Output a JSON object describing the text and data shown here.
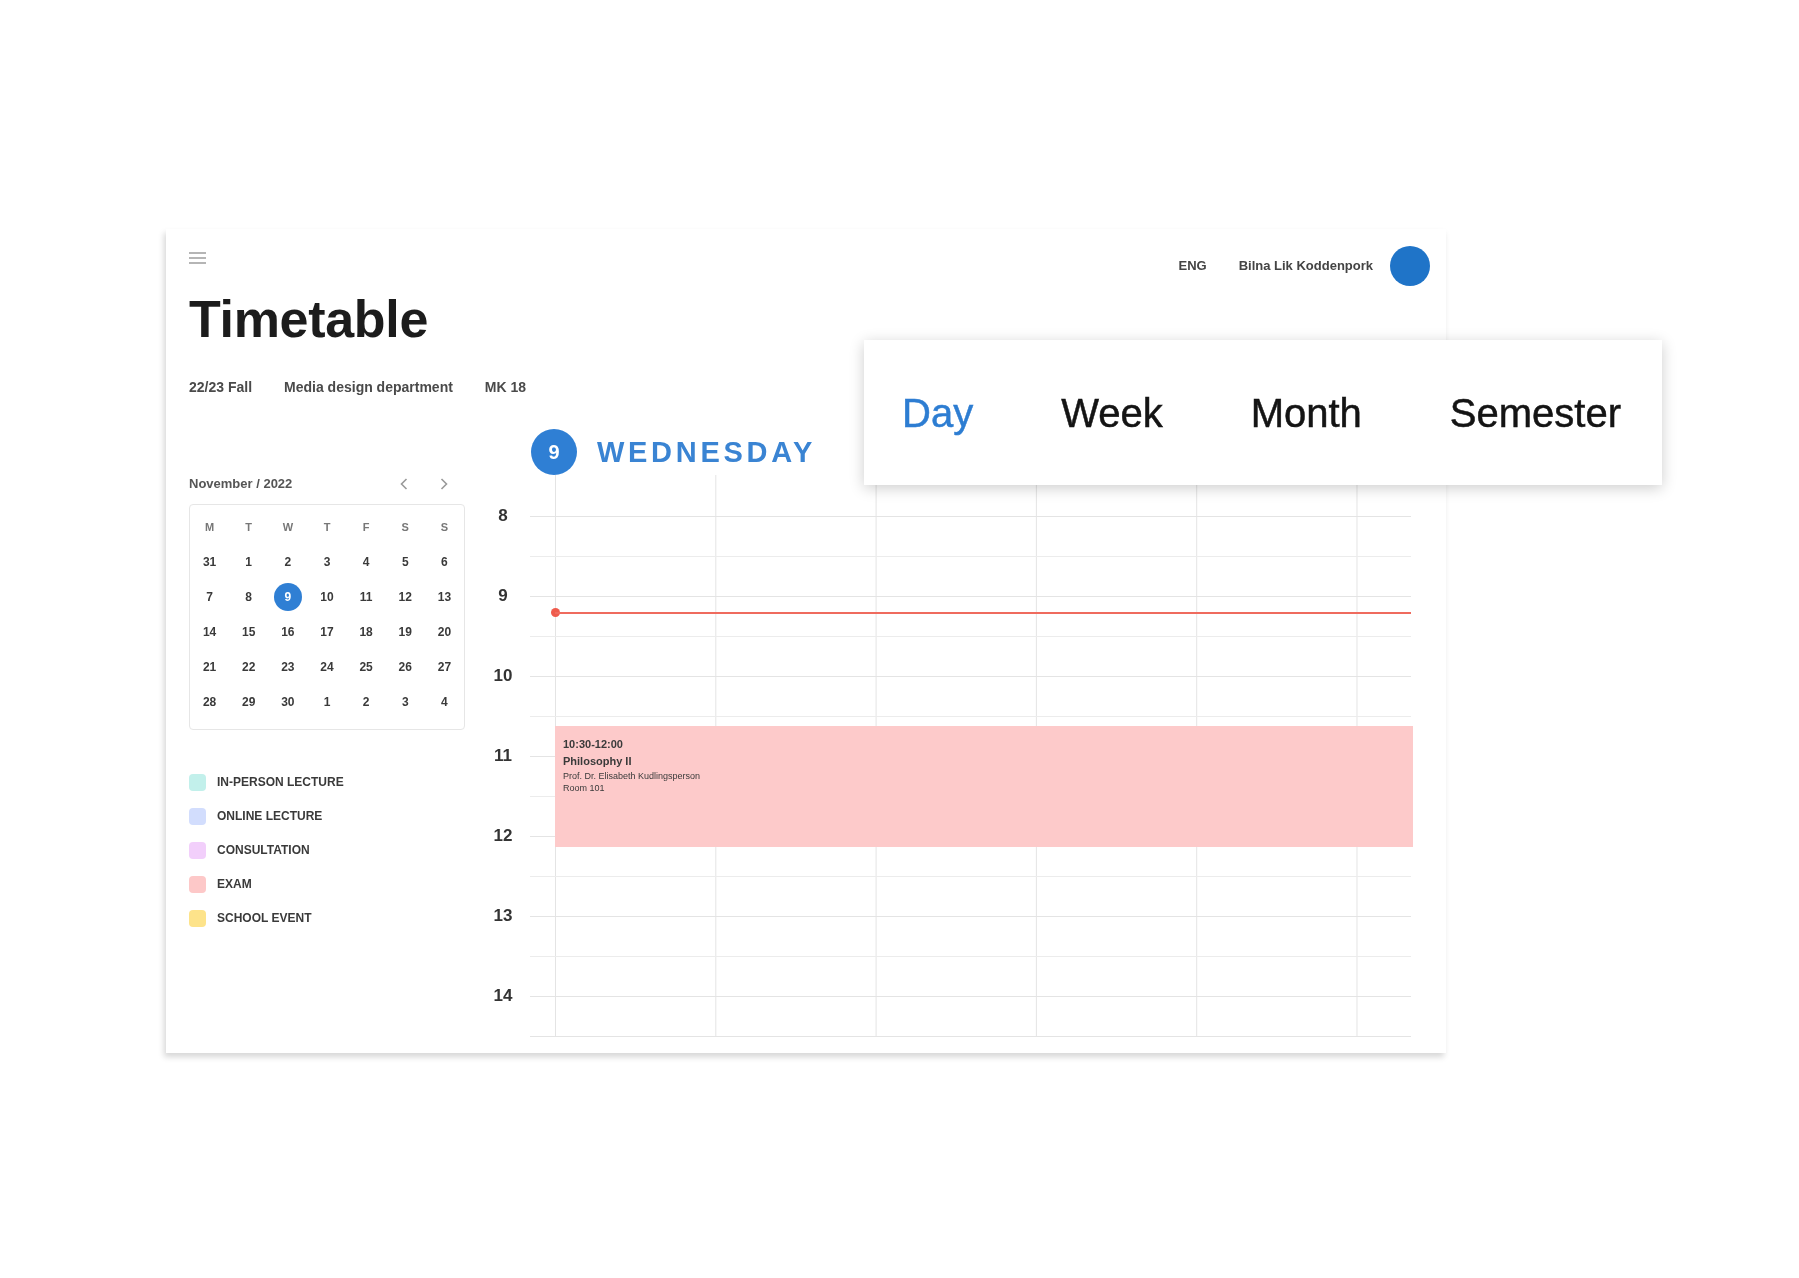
{
  "topbar": {
    "language": "ENG",
    "user_name": "Bilna Lik Koddenpork"
  },
  "title": "Timetable",
  "subtitle": [
    "22/23 Fall",
    "Media design department",
    "MK 18"
  ],
  "calendar": {
    "month": "November / 2022",
    "weekdays": [
      "M",
      "T",
      "W",
      "T",
      "F",
      "S",
      "S"
    ],
    "days": [
      {
        "label": "31",
        "selected": false
      },
      {
        "label": "1",
        "selected": false
      },
      {
        "label": "2",
        "selected": false
      },
      {
        "label": "3",
        "selected": false
      },
      {
        "label": "4",
        "selected": false
      },
      {
        "label": "5",
        "selected": false
      },
      {
        "label": "6",
        "selected": false
      },
      {
        "label": "7",
        "selected": false
      },
      {
        "label": "8",
        "selected": false
      },
      {
        "label": "9",
        "selected": true
      },
      {
        "label": "10",
        "selected": false
      },
      {
        "label": "11",
        "selected": false
      },
      {
        "label": "12",
        "selected": false
      },
      {
        "label": "13",
        "selected": false
      },
      {
        "label": "14",
        "selected": false
      },
      {
        "label": "15",
        "selected": false
      },
      {
        "label": "16",
        "selected": false
      },
      {
        "label": "17",
        "selected": false
      },
      {
        "label": "18",
        "selected": false
      },
      {
        "label": "19",
        "selected": false
      },
      {
        "label": "20",
        "selected": false
      },
      {
        "label": "21",
        "selected": false
      },
      {
        "label": "22",
        "selected": false
      },
      {
        "label": "23",
        "selected": false
      },
      {
        "label": "24",
        "selected": false
      },
      {
        "label": "25",
        "selected": false
      },
      {
        "label": "26",
        "selected": false
      },
      {
        "label": "27",
        "selected": false
      },
      {
        "label": "28",
        "selected": false
      },
      {
        "label": "29",
        "selected": false
      },
      {
        "label": "30",
        "selected": false
      },
      {
        "label": "1",
        "selected": false
      },
      {
        "label": "2",
        "selected": false
      },
      {
        "label": "3",
        "selected": false
      },
      {
        "label": "4",
        "selected": false
      }
    ]
  },
  "legend": [
    {
      "label": "IN-PERSON LECTURE",
      "color": "#c2f0eb"
    },
    {
      "label": "ONLINE LECTURE",
      "color": "#d2ddfd"
    },
    {
      "label": "CONSULTATION",
      "color": "#f2cffb"
    },
    {
      "label": "EXAM",
      "color": "#fdc8c8"
    },
    {
      "label": "SCHOOL EVENT",
      "color": "#fde38a"
    }
  ],
  "day_view": {
    "date": "9",
    "weekday": "WEDNESDAY",
    "hours": [
      {
        "label": "8",
        "current_time": false
      },
      {
        "label": "9",
        "current_time": true
      },
      {
        "label": "10",
        "current_time": false,
        "events": [
          {
            "time": "10:30-12:00",
            "title": "Philosophy II",
            "lecturer": "Prof. Dr. Elisabeth Kudlingsperson",
            "room": "Room 101",
            "color": "#fdcaca"
          }
        ]
      },
      {
        "label": "11",
        "current_time": false
      },
      {
        "label": "12",
        "current_time": false
      },
      {
        "label": "13",
        "current_time": false
      },
      {
        "label": "14",
        "current_time": false
      }
    ]
  },
  "view_tabs": [
    {
      "label": "Day",
      "selected": true
    },
    {
      "label": "Week",
      "selected": false
    },
    {
      "label": "Month",
      "selected": false
    },
    {
      "label": "Semester",
      "selected": false
    }
  ]
}
